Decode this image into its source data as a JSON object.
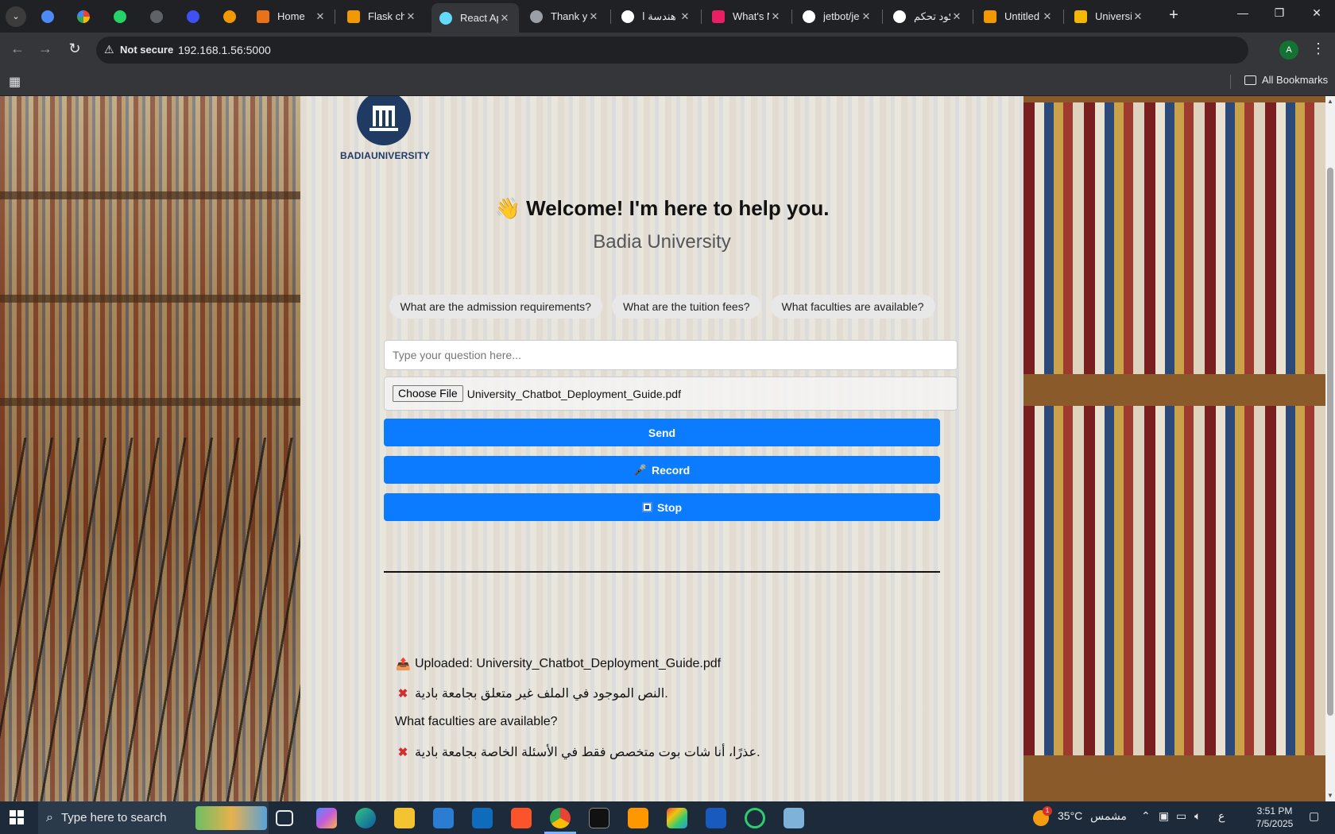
{
  "browser": {
    "tabs": [
      {
        "title": "Home",
        "color": "#e8711a"
      },
      {
        "title": "Flask ch",
        "color": "#f29900"
      },
      {
        "title": "React Ap",
        "color": "#61dafb"
      },
      {
        "title": "Thank yo",
        "color": "#9aa0a6"
      },
      {
        "title": "هندسة ا",
        "color": "#ffffff"
      },
      {
        "title": "What's N",
        "color": "#e91e63"
      },
      {
        "title": "jetbot/je",
        "color": "#ffffff"
      },
      {
        "title": "كود تحكم",
        "color": "#ffffff"
      },
      {
        "title": "Untitled",
        "color": "#f29900"
      },
      {
        "title": "Universi",
        "color": "#f2b705"
      }
    ],
    "pinned_tab_icons": [
      "blue-circle-icon",
      "google-icon",
      "whatsapp-icon",
      "globe-icon",
      "blue-circle-icon",
      "infinity-icon"
    ],
    "security_label": "Not secure",
    "url": "192.168.1.56:5000",
    "profile_initial": "A",
    "bookmarks_label": "All Bookmarks"
  },
  "page": {
    "logo_text": "BADIAUNIVERSITY",
    "welcome_emoji": "👋",
    "welcome": "Welcome! I'm here to help you.",
    "subtitle": "Badia University",
    "suggestions": [
      "What are the admission requirements?",
      "What are the tuition fees?",
      "What faculties are available?"
    ],
    "question_placeholder": "Type your question here...",
    "file_button": "Choose File",
    "file_name": "University_Chatbot_Deployment_Guide.pdf",
    "send_label": "Send",
    "record_icon": "🎤",
    "record_label": "Record",
    "stop_label": "Stop",
    "messages": [
      {
        "icon": "📤",
        "text": "Uploaded: University_Chatbot_Deployment_Guide.pdf"
      },
      {
        "icon": "✖",
        "text": "النص الموجود في الملف غير متعلق بجامعة بادية."
      },
      {
        "icon": "",
        "text": "What faculties are available?"
      },
      {
        "icon": "✖",
        "text": "عذرًا، أنا شات بوت متخصص فقط في الأسئلة الخاصة بجامعة بادية."
      }
    ]
  },
  "taskbar": {
    "search_placeholder": "Type here to search",
    "weather_temp": "35°C",
    "weather_desc": "مشمس",
    "weather_badge": "1",
    "lang": "ع",
    "time": "3:51 PM",
    "date": "7/5/2025"
  },
  "colors": {
    "primary_button": "#0b7bff",
    "error_mark": "#d32f2f",
    "chrome_dark": "#202124"
  }
}
